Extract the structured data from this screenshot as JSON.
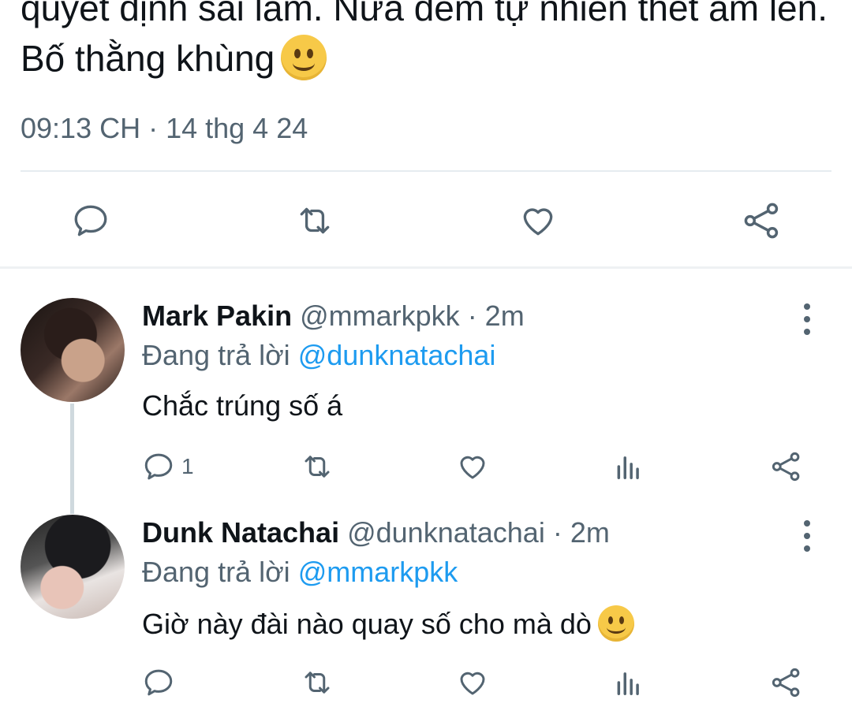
{
  "tweet": {
    "text": "quyết định sai lầm. Nửa đêm tự nhiên thét ầm lên. Bố thằng khùng",
    "timestamp": "09:13 CH · 14 thg 4 24"
  },
  "icons": {
    "reply": "reply-icon",
    "retweet": "retweet-icon",
    "like": "heart-icon",
    "share": "share-icon",
    "views": "views-icon",
    "more": "more-icon",
    "emoji": "slightly-smiling-face-emoji"
  },
  "colors": {
    "text": "#0f1419",
    "secondary": "#536471",
    "accent": "#1d9bf0",
    "divider": "#e6ecf0"
  },
  "replies": [
    {
      "name": "Mark Pakin",
      "handle": "@mmarkpkk",
      "time": "· 2m",
      "replying_label": "Đang trả lời",
      "replying_to": "@dunknatachai",
      "text": "Chắc trúng số á",
      "reply_count": "1"
    },
    {
      "name": "Dunk Natachai",
      "handle": "@dunknatachai",
      "time": "· 2m",
      "replying_label": "Đang trả lời",
      "replying_to": "@mmarkpkk",
      "text": "Giờ này đài nào quay số cho mà dò",
      "reply_count": ""
    }
  ]
}
